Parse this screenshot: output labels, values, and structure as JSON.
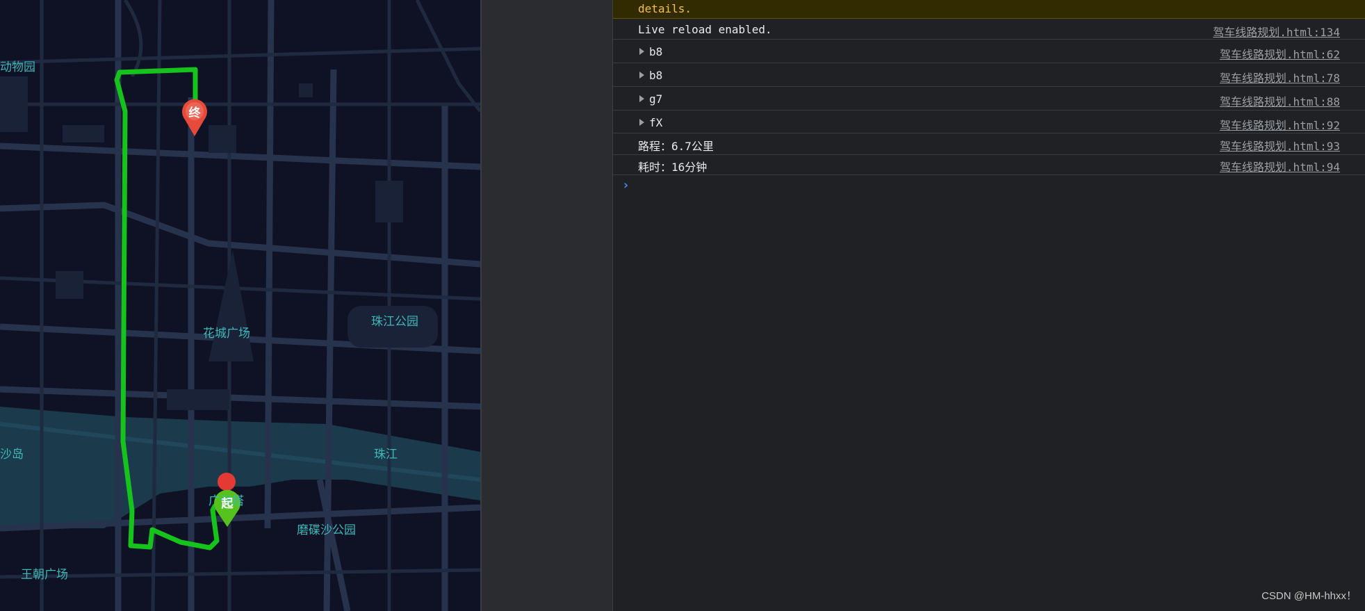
{
  "map": {
    "labels": [
      "动物园",
      "花城广场",
      "珠江公园",
      "沙岛",
      "珠江",
      "广州塔",
      "磨碟沙公园",
      "王朝广场"
    ],
    "start_marker": "起",
    "end_marker": "终",
    "route_color": "#16c21c",
    "start_color": "#56c21e",
    "end_color": "#e84a3a"
  },
  "console": {
    "rows": [
      {
        "msg": "details.",
        "src": ""
      },
      {
        "msg": "Live reload enabled.",
        "src": "驾车线路规划.html:134"
      },
      {
        "msg": "b8",
        "src": "驾车线路规划.html:62"
      },
      {
        "msg": "b8",
        "src": "驾车线路规划.html:78"
      },
      {
        "msg": "g7",
        "src": "驾车线路规划.html:88"
      },
      {
        "msg": "fX",
        "src": "驾车线路规划.html:92"
      },
      {
        "msg": "路程：6.7公里",
        "src": "驾车线路规划.html:93"
      },
      {
        "msg": "耗时：16分钟",
        "src": "驾车线路规划.html:94"
      }
    ],
    "prompt": "›"
  },
  "watermark": "CSDN @HM-hhxx！"
}
